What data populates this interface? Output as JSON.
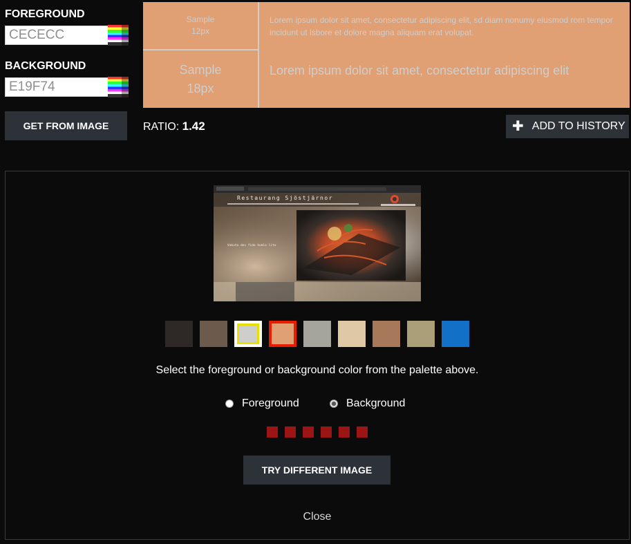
{
  "foreground": {
    "label": "FOREGROUND",
    "value": "CECECC",
    "color": "#cececc"
  },
  "background": {
    "label": "BACKGROUND",
    "value": "E19F74",
    "color": "#e19f74"
  },
  "get_from_image_label": "GET FROM IMAGE",
  "sample": {
    "small_label_line1": "Sample",
    "small_label_line2": "12px",
    "small_text": "Lorem ipsum dolor sit amet, consectetur adipiscing elit, sd diam nonumy eiusmod rom tempor incidunt ut lsbore et dolore magna aliquam erat volupat.",
    "large_label_line1": "Sample",
    "large_label_line2": "18px",
    "large_text": "Lorem ipsum dolor sit amet, consectetur adipiscing elit"
  },
  "ratio": {
    "label": "RATIO:",
    "value": "1.42"
  },
  "add_to_history_label": "ADD TO HISTORY",
  "thumbnail": {
    "site_title": "Restaurang Sjöstjärnor",
    "tagline": "Vakuta des fido humlo lite"
  },
  "palette": [
    {
      "color": "#2e2926",
      "state": "none"
    },
    {
      "color": "#6c5b4d",
      "state": "none"
    },
    {
      "color": "#cececc",
      "state": "foreground"
    },
    {
      "color": "#e19f74",
      "state": "background"
    },
    {
      "color": "#a6a59b",
      "state": "none"
    },
    {
      "color": "#dfc8a6",
      "state": "none"
    },
    {
      "color": "#a7785a",
      "state": "none"
    },
    {
      "color": "#ab9f7a",
      "state": "none"
    },
    {
      "color": "#1270c6",
      "state": "none"
    }
  ],
  "instructions": "Select the foreground or background color from the palette above.",
  "radio_foreground_label": "Foreground",
  "radio_background_label": "Background",
  "selected_mode": "background",
  "try_different_image_label": "TRY DIFFERENT IMAGE",
  "close_label": "Close",
  "colors": {
    "page_bg": "#0b0b0b",
    "button_bg": "#2d3238",
    "dot_color": "#9c1515"
  }
}
